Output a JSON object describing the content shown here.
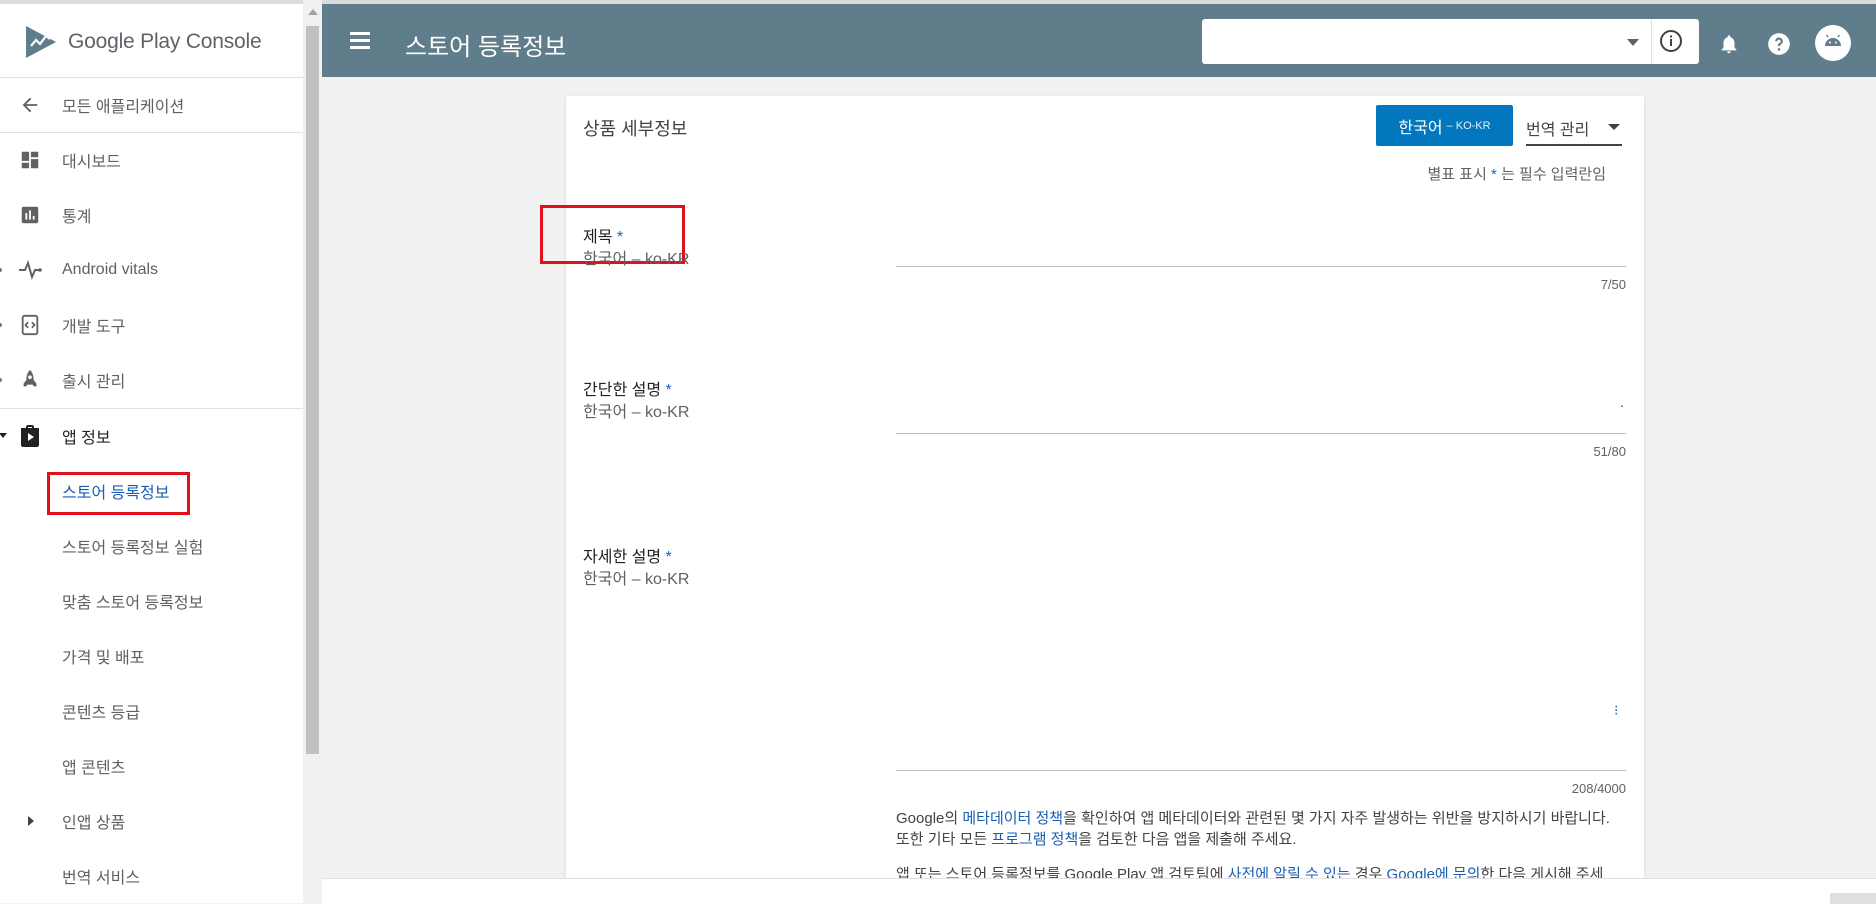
{
  "sidebar": {
    "logo_text": "Google Play Console",
    "back_label": "모든 애플리케이션",
    "items": [
      {
        "label": "대시보드",
        "icon": "dashboard-icon"
      },
      {
        "label": "통계",
        "icon": "bar-chart-icon"
      },
      {
        "label": "Android vitals",
        "icon": "pulse-icon"
      },
      {
        "label": "개발 도구",
        "icon": "dev-tools-icon"
      },
      {
        "label": "출시 관리",
        "icon": "rocket-icon"
      },
      {
        "label": "앱 정보",
        "icon": "play-store-bag-icon"
      }
    ],
    "subitems": [
      {
        "label": "스토어 등록정보",
        "active": true
      },
      {
        "label": "스토어 등록정보 실험"
      },
      {
        "label": "맞춤 스토어 등록정보"
      },
      {
        "label": "가격 및 배포"
      },
      {
        "label": "콘텐츠 등급"
      },
      {
        "label": "앱 콘텐츠"
      },
      {
        "label": "인앱 상품"
      },
      {
        "label": "번역 서비스"
      }
    ]
  },
  "header": {
    "title": "스토어 등록정보",
    "app_select_value": ""
  },
  "card": {
    "title": "상품 세부정보",
    "language_button": {
      "label": "한국어",
      "code": "– KO-KR"
    },
    "translate_button": "번역 관리",
    "required_note": {
      "prefix": "별표 표시",
      "star": "*",
      "suffix": "는 필수 입력란임"
    },
    "fields": [
      {
        "label": "제목",
        "star": "*",
        "sublabel": "한국어 – ko-KR",
        "counter": "7/50",
        "mark": ""
      },
      {
        "label": "간단한 설명",
        "star": "*",
        "sublabel": "한국어 – ko-KR",
        "counter": "51/80",
        "mark": "."
      },
      {
        "label": "자세한 설명",
        "star": "*",
        "sublabel": "한국어 – ko-KR",
        "counter": "208/4000",
        "mark": "⁝"
      }
    ],
    "policy": {
      "t1": "Google의 ",
      "link1": "메타데이터 정책",
      "t2": "을 확인하여 앱 메타데이터와 관련된 몇 가지 자주 발생하는 위반을 방지하시기 바랍니다. 또한 기타 모든 ",
      "link2": "프로그램 정책",
      "t3": "을 검토한 다음 앱을 제출해 주세요.",
      "t4": "앱 또는 스토어 등록정보를 Google Play 앱 검토팀에 ",
      "link3": "사전에 알릴 수 있는",
      "t5": " 경우 ",
      "link4": "Google에 문의",
      "t6": "한 다음 게시해 주세"
    }
  },
  "colors": {
    "topbar": "#607d8b",
    "accent": "#0277bd",
    "link": "#1a5fb4",
    "highlight": "#e0101a"
  }
}
